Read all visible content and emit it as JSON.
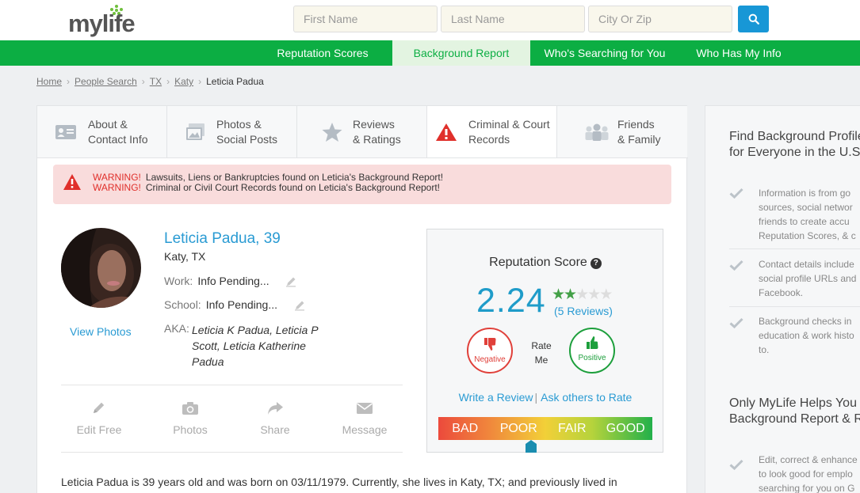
{
  "brand": {
    "logo_text": "mylife"
  },
  "search": {
    "first_placeholder": "First Name",
    "last_placeholder": "Last Name",
    "city_placeholder": "City Or Zip"
  },
  "nav": {
    "items": [
      {
        "label": "Reputation Scores"
      },
      {
        "label": "Background Report"
      },
      {
        "label": "Who's Searching for You"
      },
      {
        "label": "Who Has My Info"
      }
    ],
    "active_index": 1
  },
  "breadcrumb": {
    "items": [
      "Home",
      "People Search",
      "TX",
      "Katy"
    ],
    "current": "Leticia Padua"
  },
  "tabs": [
    {
      "line1": "About &",
      "line2": "Contact Info",
      "icon": "contact-card-icon"
    },
    {
      "line1": "Photos &",
      "line2": "Social Posts",
      "icon": "photos-icon"
    },
    {
      "line1": "Reviews",
      "line2": "& Ratings",
      "icon": "star-icon"
    },
    {
      "line1": "Criminal & Court",
      "line2": "Records",
      "icon": "warning-icon"
    },
    {
      "line1": "Friends",
      "line2": "& Family",
      "icon": "people-icon"
    }
  ],
  "warnings": [
    {
      "tag": "WARNING!",
      "text": "Lawsuits, Liens or Bankruptcies found on Leticia's Background Report!"
    },
    {
      "tag": "WARNING!",
      "text": "Criminal or Civil Court Records found on Leticia's Background Report!"
    }
  ],
  "profile": {
    "name": "Leticia Padua, 39",
    "location": "Katy, TX",
    "work_label": "Work:",
    "work_value": "Info Pending...",
    "school_label": "School:",
    "school_value": "Info Pending...",
    "aka_label": "AKA:",
    "aka_value": "Leticia K Padua, Leticia P Scott, Leticia Katherine Padua",
    "view_photos": "View Photos"
  },
  "actions": [
    {
      "label": "Edit Free",
      "icon": "pencil-icon"
    },
    {
      "label": "Photos",
      "icon": "camera-icon"
    },
    {
      "label": "Share",
      "icon": "share-icon"
    },
    {
      "label": "Message",
      "icon": "envelope-icon"
    }
  ],
  "reputation": {
    "title": "Reputation Score",
    "score": "2.24",
    "stars": 2,
    "stars_max": 5,
    "reviews": "(5 Reviews)",
    "negative": "Negative",
    "positive": "Positive",
    "rate_line1": "Rate",
    "rate_line2": "Me",
    "write_review": "Write a Review",
    "ask_others": "Ask others to Rate",
    "meter_labels": [
      "BAD",
      "POOR",
      "FAIR",
      "GOOD"
    ],
    "meter_level": "POOR"
  },
  "bio": {
    "text": "Leticia Padua is 39 years old and was born on 03/11/1979. Currently, she lives in Katy, TX; and previously lived in"
  },
  "sidebar": {
    "heading1_line1": "Find Background Profiles",
    "heading1_line2": "for Everyone in the U.S.",
    "items": [
      {
        "lines": [
          "Information is from go",
          "sources, social networ",
          "friends to create accu",
          "Reputation Scores, & c"
        ]
      },
      {
        "lines": [
          "Contact details include",
          "social profile URLs and",
          "Facebook."
        ]
      },
      {
        "lines": [
          "Background checks in",
          "education & work histo",
          "to."
        ]
      }
    ],
    "heading2_line1": "Only MyLife Helps You",
    "heading2_line2": "Background Report & R",
    "item4": {
      "lines": [
        "Edit, correct & enhance",
        "to look good for emplo",
        "searching for you on G"
      ]
    }
  },
  "colors": {
    "green_nav": "#0cae43",
    "link_blue": "#2a9bd3",
    "score_blue": "#1f9cc9",
    "warning_red": "#e0302b"
  }
}
